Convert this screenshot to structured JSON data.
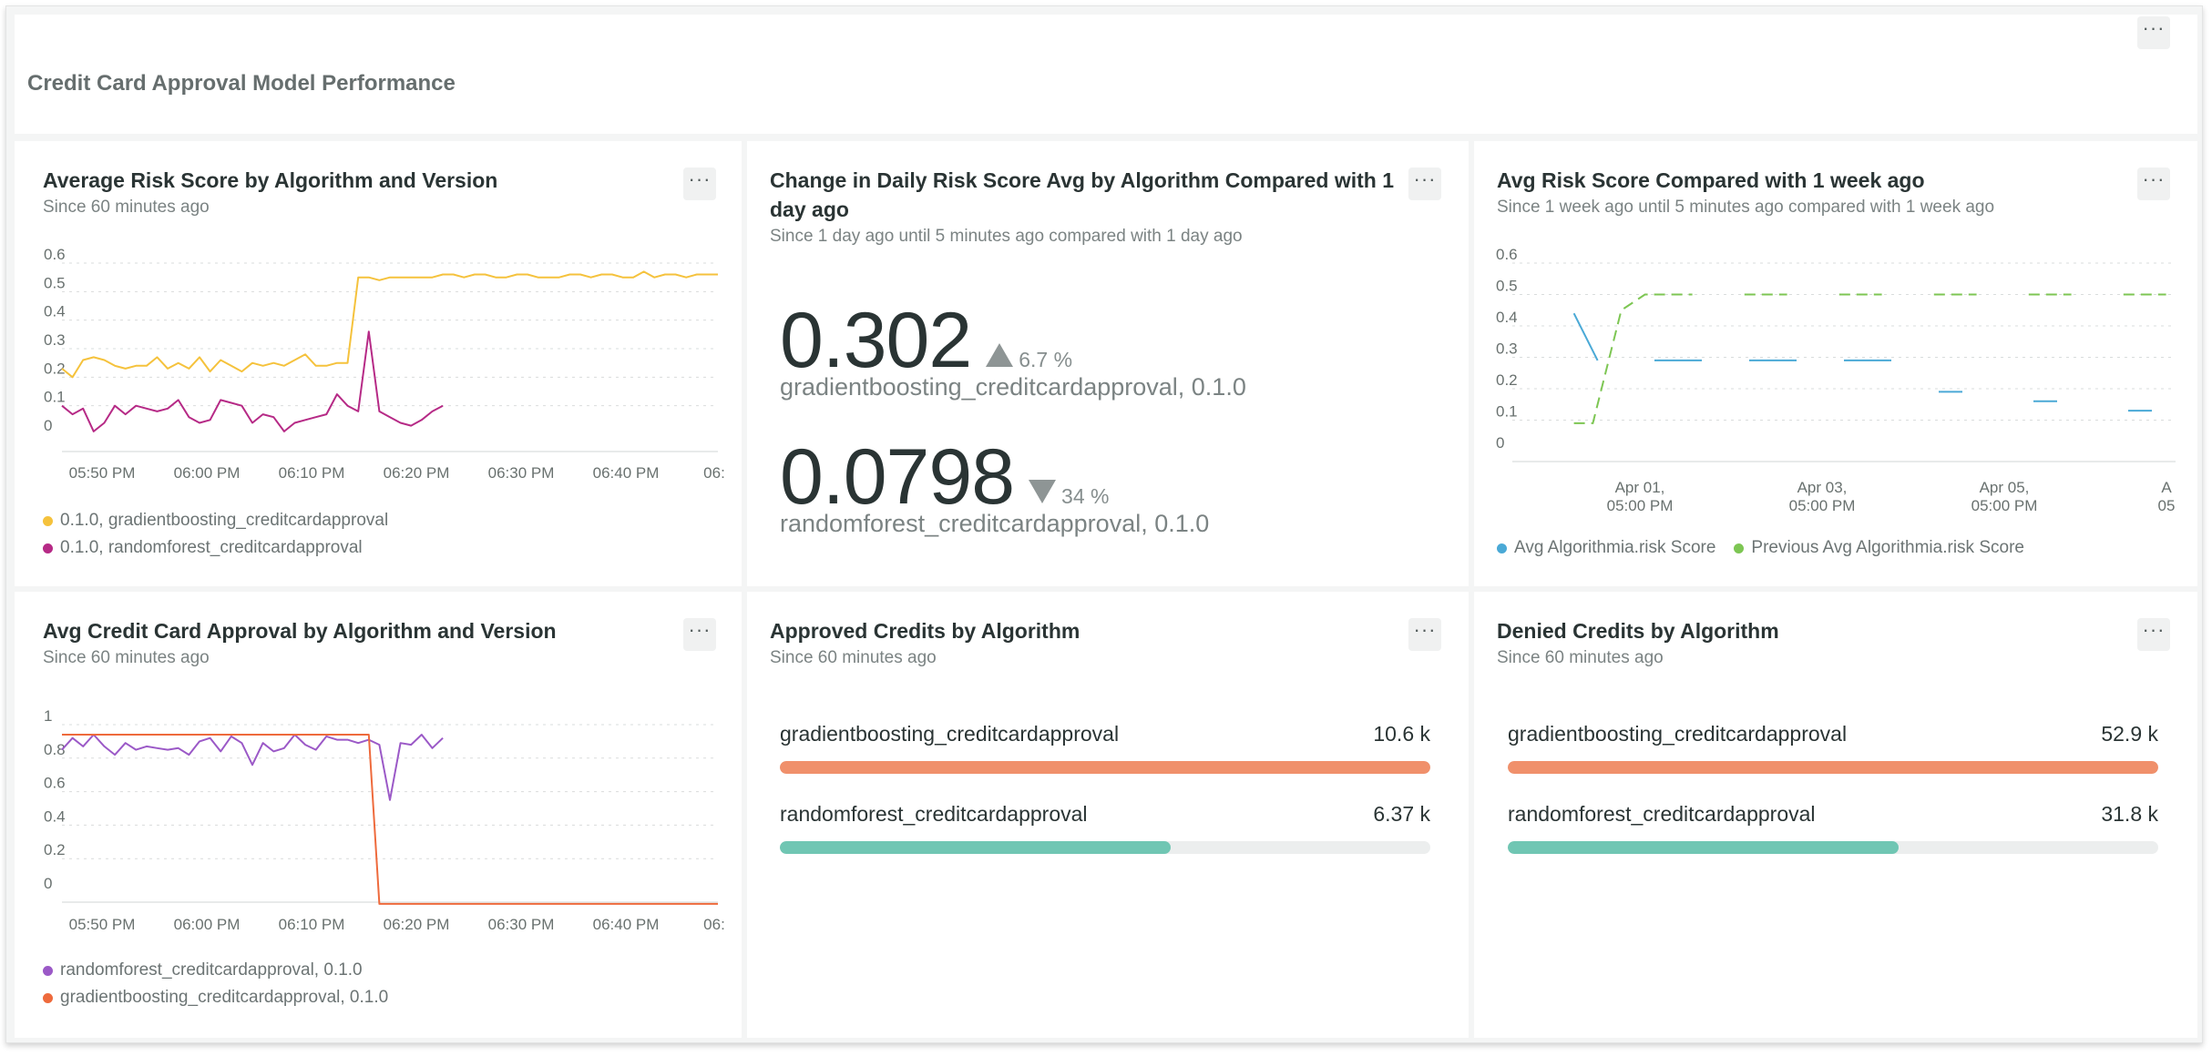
{
  "dashboard": {
    "title": "Credit Card Approval Model Performance",
    "menu_glyph": "···"
  },
  "panels": {
    "avg_risk": {
      "title": "Average Risk Score by Algorithm and Version",
      "subtitle": "Since 60 minutes ago",
      "menu_glyph": "···",
      "legend": [
        "0.1.0, gradientboosting_creditcardapproval",
        "0.1.0, randomforest_creditcardapproval"
      ]
    },
    "change_daily": {
      "title_line1": "Change in Daily Risk Score Avg by Algorithm Compared with 1",
      "title_line2": "day ago",
      "subtitle": "Since 1 day ago until 5 minutes ago compared with 1 day ago",
      "menu_glyph": "···",
      "metrics": [
        {
          "value": "0.302",
          "delta": "6.7 %",
          "direction": "up",
          "label": "gradientboosting_creditcardapproval, 0.1.0"
        },
        {
          "value": "0.0798",
          "delta": "34 %",
          "direction": "down",
          "label": "randomforest_creditcardapproval, 0.1.0"
        }
      ]
    },
    "avg_week": {
      "title": "Avg Risk Score Compared with 1 week ago",
      "subtitle": "Since 1 week ago until 5 minutes ago compared with 1 week ago",
      "menu_glyph": "···",
      "legend": [
        "Avg Algorithmia.risk Score",
        "Previous Avg Algorithmia.risk Score"
      ]
    },
    "avg_approval": {
      "title": "Avg Credit Card Approval by Algorithm and Version",
      "subtitle": "Since 60 minutes ago",
      "menu_glyph": "···",
      "legend": [
        "randomforest_creditcardapproval, 0.1.0",
        "gradientboosting_creditcardapproval, 0.1.0"
      ]
    },
    "approved": {
      "title": "Approved Credits by Algorithm",
      "subtitle": "Since 60 minutes ago",
      "menu_glyph": "···",
      "rows": [
        {
          "label": "gradientboosting_creditcardapproval",
          "value_text": "10.6 k",
          "value": 10600,
          "color": "#f0906b"
        },
        {
          "label": "randomforest_creditcardapproval",
          "value_text": "6.37 k",
          "value": 6370,
          "color": "#70c6b3"
        }
      ]
    },
    "denied": {
      "title": "Denied Credits by Algorithm",
      "subtitle": "Since 60 minutes ago",
      "menu_glyph": "···",
      "rows": [
        {
          "label": "gradientboosting_creditcardapproval",
          "value_text": "52.9 k",
          "value": 52900,
          "color": "#f0906b"
        },
        {
          "label": "randomforest_creditcardapproval",
          "value_text": "31.8 k",
          "value": 31800,
          "color": "#70c6b3"
        }
      ]
    }
  },
  "chart_data": [
    {
      "id": "avg_risk",
      "type": "line",
      "title": "Average Risk Score by Algorithm and Version",
      "xlabel": "",
      "ylabel": "",
      "ylim": [
        0,
        0.6
      ],
      "yticks": [
        "0",
        "0.1",
        "0.2",
        "0.3",
        "0.4",
        "0.5",
        "0.6"
      ],
      "xticks": [
        "05:50 PM",
        "06:00 PM",
        "06:10 PM",
        "06:20 PM",
        "06:30 PM",
        "06:40 PM",
        "06:"
      ],
      "x_range": [
        0,
        62
      ],
      "grid": true,
      "series": [
        {
          "name": "0.1.0, gradientboosting_creditcardapproval",
          "color": "#f5c23c",
          "x": [
            0,
            1,
            2,
            3,
            4,
            5,
            6,
            7,
            8,
            9,
            10,
            11,
            12,
            13,
            14,
            15,
            16,
            17,
            18,
            19,
            20,
            21,
            22,
            23,
            24,
            25,
            26,
            27,
            28,
            29,
            30,
            31,
            32,
            33,
            34,
            35,
            36,
            37,
            38,
            39,
            40,
            41,
            42,
            43,
            44,
            45,
            46,
            47,
            48,
            49,
            50,
            51,
            52,
            53,
            54,
            55,
            56,
            57,
            58,
            59,
            60,
            61,
            62
          ],
          "values": [
            0.23,
            0.2,
            0.26,
            0.27,
            0.26,
            0.24,
            0.23,
            0.24,
            0.24,
            0.27,
            0.23,
            0.25,
            0.23,
            0.27,
            0.22,
            0.26,
            0.24,
            0.22,
            0.25,
            0.24,
            0.25,
            0.24,
            0.26,
            0.28,
            0.24,
            0.24,
            0.25,
            0.25,
            0.55,
            0.55,
            0.54,
            0.55,
            0.55,
            0.55,
            0.55,
            0.55,
            0.56,
            0.56,
            0.55,
            0.56,
            0.56,
            0.55,
            0.55,
            0.56,
            0.56,
            0.55,
            0.55,
            0.55,
            0.56,
            0.56,
            0.55,
            0.56,
            0.56,
            0.55,
            0.55,
            0.57,
            0.55,
            0.56,
            0.56,
            0.55,
            0.56,
            0.56,
            0.56
          ]
        },
        {
          "name": "0.1.0, randomforest_creditcardapproval",
          "color": "#b62a86",
          "x": [
            0,
            1,
            2,
            3,
            4,
            5,
            6,
            7,
            8,
            9,
            10,
            11,
            12,
            13,
            14,
            15,
            16,
            17,
            18,
            19,
            20,
            21,
            22,
            23,
            24,
            25,
            26,
            27,
            28,
            29,
            30,
            31,
            32,
            33,
            34,
            35,
            36
          ],
          "values": [
            0.1,
            0.07,
            0.09,
            0.01,
            0.04,
            0.1,
            0.07,
            0.1,
            0.09,
            0.08,
            0.09,
            0.12,
            0.06,
            0.04,
            0.05,
            0.12,
            0.11,
            0.1,
            0.04,
            0.07,
            0.06,
            0.01,
            0.04,
            0.05,
            0.06,
            0.07,
            0.14,
            0.1,
            0.08,
            0.36,
            0.08,
            0.06,
            0.04,
            0.03,
            0.05,
            0.08,
            0.1
          ]
        }
      ]
    },
    {
      "id": "avg_week",
      "type": "line",
      "title": "Avg Risk Score Compared with 1 week ago",
      "xlabel": "",
      "ylabel": "",
      "ylim": [
        0,
        0.6
      ],
      "yticks": [
        "0",
        "0.1",
        "0.2",
        "0.3",
        "0.4",
        "0.5",
        "0.6"
      ],
      "xticks": [
        [
          "Apr 01,",
          "05:00 PM"
        ],
        [
          "Apr 03,",
          "05:00 PM"
        ],
        [
          "Apr 05,",
          "05:00 PM"
        ],
        [
          "A",
          "05"
        ]
      ],
      "x_range": [
        0,
        7
      ],
      "grid": true,
      "series": [
        {
          "name": "Avg Algorithmia.risk Score",
          "color": "#4aa9d6",
          "dash": "",
          "segments": [
            [
              [
                0.65,
                0.44
              ],
              [
                0.9,
                0.29
              ]
            ],
            [
              [
                1.5,
                0.29
              ],
              [
                2.0,
                0.29
              ]
            ],
            [
              [
                2.5,
                0.29
              ],
              [
                3.0,
                0.29
              ]
            ],
            [
              [
                3.5,
                0.29
              ],
              [
                4.0,
                0.29
              ]
            ],
            [
              [
                4.5,
                0.19
              ],
              [
                4.75,
                0.19
              ]
            ],
            [
              [
                5.5,
                0.16
              ],
              [
                5.75,
                0.16
              ]
            ],
            [
              [
                6.5,
                0.13
              ],
              [
                6.75,
                0.13
              ]
            ]
          ]
        },
        {
          "name": "Previous Avg Algorithmia.risk Score",
          "color": "#7dc653",
          "dash": "12 7",
          "segments": [
            [
              [
                0.65,
                0.09
              ],
              [
                0.85,
                0.09
              ],
              [
                1.15,
                0.45
              ],
              [
                1.4,
                0.5
              ],
              [
                1.9,
                0.5
              ]
            ],
            [
              [
                2.45,
                0.5
              ],
              [
                2.9,
                0.5
              ]
            ],
            [
              [
                3.45,
                0.5
              ],
              [
                3.9,
                0.5
              ]
            ],
            [
              [
                4.45,
                0.5
              ],
              [
                4.9,
                0.5
              ]
            ],
            [
              [
                5.45,
                0.5
              ],
              [
                5.9,
                0.5
              ]
            ],
            [
              [
                6.45,
                0.5
              ],
              [
                6.9,
                0.5
              ]
            ]
          ]
        }
      ]
    },
    {
      "id": "avg_approval",
      "type": "line",
      "title": "Avg Credit Card Approval by Algorithm and Version",
      "xlabel": "",
      "ylabel": "",
      "ylim": [
        0,
        1
      ],
      "yticks": [
        "0",
        "0.2",
        "0.4",
        "0.6",
        "0.8",
        "1"
      ],
      "xticks": [
        "05:50 PM",
        "06:00 PM",
        "06:10 PM",
        "06:20 PM",
        "06:30 PM",
        "06:40 PM",
        "06:"
      ],
      "x_range": [
        0,
        62
      ],
      "grid": true,
      "series": [
        {
          "name": "randomforest_creditcardapproval, 0.1.0",
          "color": "#9b59c7",
          "x": [
            0,
            1,
            2,
            3,
            4,
            5,
            6,
            7,
            8,
            9,
            10,
            11,
            12,
            13,
            14,
            15,
            16,
            17,
            18,
            19,
            20,
            21,
            22,
            23,
            24,
            25,
            26,
            27,
            28,
            29,
            30,
            31,
            32,
            33,
            34,
            35,
            36
          ],
          "values": [
            0.85,
            0.92,
            0.87,
            0.94,
            0.87,
            0.82,
            0.89,
            0.85,
            0.87,
            0.86,
            0.85,
            0.86,
            0.82,
            0.9,
            0.92,
            0.84,
            0.93,
            0.89,
            0.76,
            0.89,
            0.84,
            0.86,
            0.94,
            0.88,
            0.85,
            0.93,
            0.91,
            0.91,
            0.89,
            0.91,
            0.88,
            0.55,
            0.89,
            0.88,
            0.94,
            0.86,
            0.92
          ]
        },
        {
          "name": "gradientboosting_creditcardapproval, 0.1.0",
          "color": "#ee6a3c",
          "x": [
            0,
            29,
            30,
            62
          ],
          "values": [
            0.94,
            0.94,
            -0.07,
            -0.07
          ]
        }
      ]
    },
    {
      "id": "approved",
      "type": "bar",
      "title": "Approved Credits by Algorithm",
      "categories": [
        "gradientboosting_creditcardapproval",
        "randomforest_creditcardapproval"
      ],
      "values": [
        10600,
        6370
      ]
    },
    {
      "id": "denied",
      "type": "bar",
      "title": "Denied Credits by Algorithm",
      "categories": [
        "gradientboosting_creditcardapproval",
        "randomforest_creditcardapproval"
      ],
      "values": [
        52900,
        31800
      ]
    }
  ]
}
